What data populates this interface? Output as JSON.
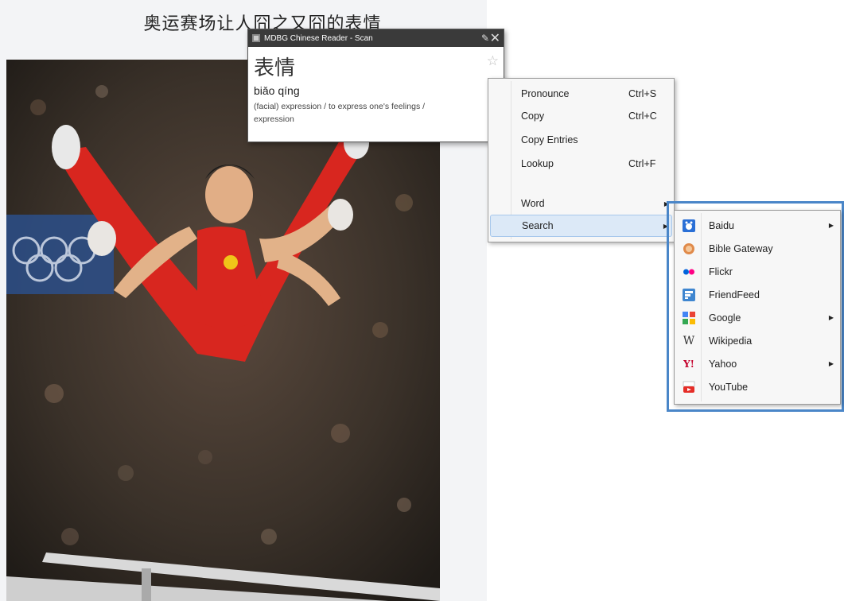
{
  "article": {
    "headline": "奥运赛场让人囧之又囧的表情",
    "photo_alt": "gymnast on parallel bars"
  },
  "popup": {
    "title": "MDBG Chinese Reader - Scan",
    "word": "表情",
    "pinyin": "biǎo qíng",
    "definition_1": "(facial) expression / to express one's feelings /",
    "definition_2": "expression",
    "icons": {
      "app": "app-icon",
      "pin": "pin-icon",
      "close": "close-icon",
      "favorite": "star-icon"
    }
  },
  "context_menu": {
    "items": [
      {
        "label": "Pronounce",
        "shortcut": "Ctrl+S"
      },
      {
        "label": "Copy",
        "shortcut": "Ctrl+C"
      },
      {
        "label": "Copy Entries",
        "shortcut": ""
      },
      {
        "label": "Lookup",
        "shortcut": "Ctrl+F"
      },
      {
        "label": "Word",
        "shortcut": "",
        "submenu": true
      },
      {
        "label": "Search",
        "shortcut": "",
        "submenu": true,
        "selected": true
      }
    ]
  },
  "search_submenu": {
    "items": [
      {
        "label": "Baidu",
        "icon": "baidu-icon",
        "submenu": true
      },
      {
        "label": "Bible Gateway",
        "icon": "bible-gateway-icon"
      },
      {
        "label": "Flickr",
        "icon": "flickr-icon"
      },
      {
        "label": "FriendFeed",
        "icon": "friendfeed-icon"
      },
      {
        "label": "Google",
        "icon": "google-icon",
        "submenu": true
      },
      {
        "label": "Wikipedia",
        "icon": "wikipedia-icon"
      },
      {
        "label": "Yahoo",
        "icon": "yahoo-icon",
        "submenu": true
      },
      {
        "label": "YouTube",
        "icon": "youtube-icon"
      }
    ]
  },
  "colors": {
    "highlight_frame": "#4a86c8",
    "selected_item": "#dce9f7",
    "titlebar": "#3a3a3a"
  }
}
